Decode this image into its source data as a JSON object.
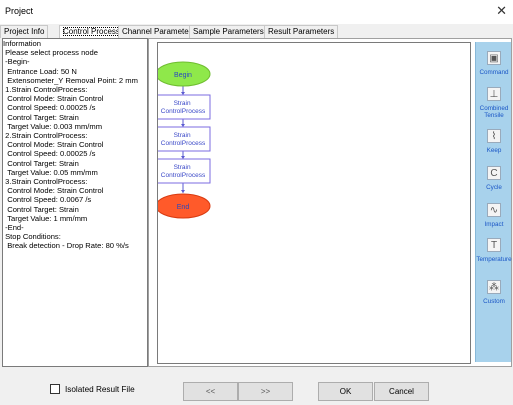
{
  "window": {
    "title": "Project",
    "close_glyph": "✕"
  },
  "tabs": [
    {
      "label": "Project Info",
      "active": false
    },
    {
      "label": "Control Process",
      "active": true
    },
    {
      "label": "Channel Parameters",
      "active": false
    },
    {
      "label": "Sample Parameters",
      "active": false
    },
    {
      "label": "Result Parameters",
      "active": false
    }
  ],
  "info": {
    "lines": [
      "Information",
      " Please select process node",
      " -Begin-",
      "  Entrance Load: 50 N",
      "  Extensometer_Y Removal Point: 2 mm",
      " 1.Strain ControlProcess:",
      "  Control Mode: Strain Control",
      "  Control Speed: 0.00025 /s",
      "  Control Target: Strain",
      "  Target Value: 0.003 mm/mm",
      " 2.Strain ControlProcess:",
      "  Control Mode: Strain Control",
      "  Control Speed: 0.00025 /s",
      "  Control Target: Strain",
      "  Target Value: 0.05 mm/mm",
      " 3.Strain ControlProcess:",
      "  Control Mode: Strain Control",
      "  Control Speed: 0.0067 /s",
      "  Control Target: Strain",
      "  Target Value: 1 mm/mm",
      " -End-",
      " Stop Conditions:",
      "  Break detection - Drop Rate: 80 %/s"
    ]
  },
  "flowchart": {
    "begin": "Begin",
    "processes": [
      "Strain ControlProcess",
      "Strain ControlProcess",
      "Strain ControlProcess"
    ],
    "end": "End",
    "colors": {
      "begin": "#8fe84a",
      "end": "#ff5a2a",
      "box_border": "#7b6be0",
      "connector": "#5a5ad0",
      "box_text": "#3a48c8"
    }
  },
  "toolbox": [
    {
      "label": "Command",
      "icon": "command-icon",
      "glyph": "▣"
    },
    {
      "label": "Combined Tensile",
      "icon": "combined-tensile-icon",
      "glyph": "⊥"
    },
    {
      "label": "Keep",
      "icon": "keep-icon",
      "glyph": "⌇"
    },
    {
      "label": "Cycle",
      "icon": "cycle-icon",
      "glyph": "C"
    },
    {
      "label": "Impact",
      "icon": "impact-icon",
      "glyph": "∿"
    },
    {
      "label": "Temperature",
      "icon": "temperature-icon",
      "glyph": "T"
    },
    {
      "label": "Custom",
      "icon": "custom-icon",
      "glyph": "⁂"
    }
  ],
  "footer": {
    "checkbox_label": "Isolated Result File",
    "checkbox_checked": false,
    "prev_label": "<<",
    "next_label": ">>",
    "ok_label": "OK",
    "cancel_label": "Cancel"
  }
}
